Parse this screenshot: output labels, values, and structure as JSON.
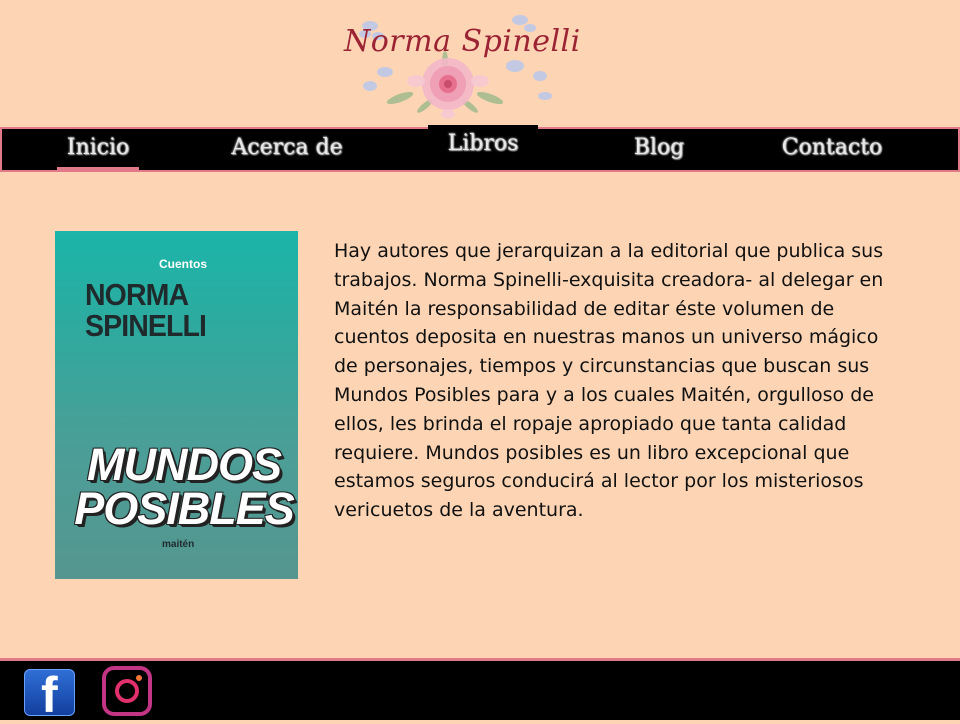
{
  "site": {
    "logo_text": "Norma Spinelli"
  },
  "nav": {
    "items": [
      {
        "label": "Inicio"
      },
      {
        "label": "Acerca de"
      },
      {
        "label": "Libros"
      },
      {
        "label": "Blog"
      },
      {
        "label": "Contacto"
      }
    ]
  },
  "book": {
    "cover_label": "Cuentos",
    "cover_author_line1": "NORMA",
    "cover_author_line2": "SPINELLI",
    "cover_title_line1": "MUNDOS",
    "cover_title_line2": "POSIBLES",
    "cover_publisher": "maitén",
    "description": "Hay autores que jerarquizan a la editorial que publica sus trabajos. Norma Spinelli-exquisita creadora- al delegar en Maitén la responsabilidad de editar éste volumen de cuentos deposita en nuestras manos un universo mágico de personajes, tiempos y circunstancias que buscan sus Mundos Posibles para y a los cuales Maitén,  orgulloso de ellos, les brinda el ropaje apropiado que tanta calidad requiere. Mundos posibles es un libro excepcional que estamos seguros conducirá al lector por los misteriosos vericuetos de la aventura."
  },
  "footer": {
    "icons": [
      "facebook-icon",
      "instagram-icon"
    ]
  },
  "colors": {
    "background": "#fdd5b5",
    "nav_bg": "#000000",
    "accent_border": "#e07a88",
    "logo_text": "#9b2333"
  }
}
